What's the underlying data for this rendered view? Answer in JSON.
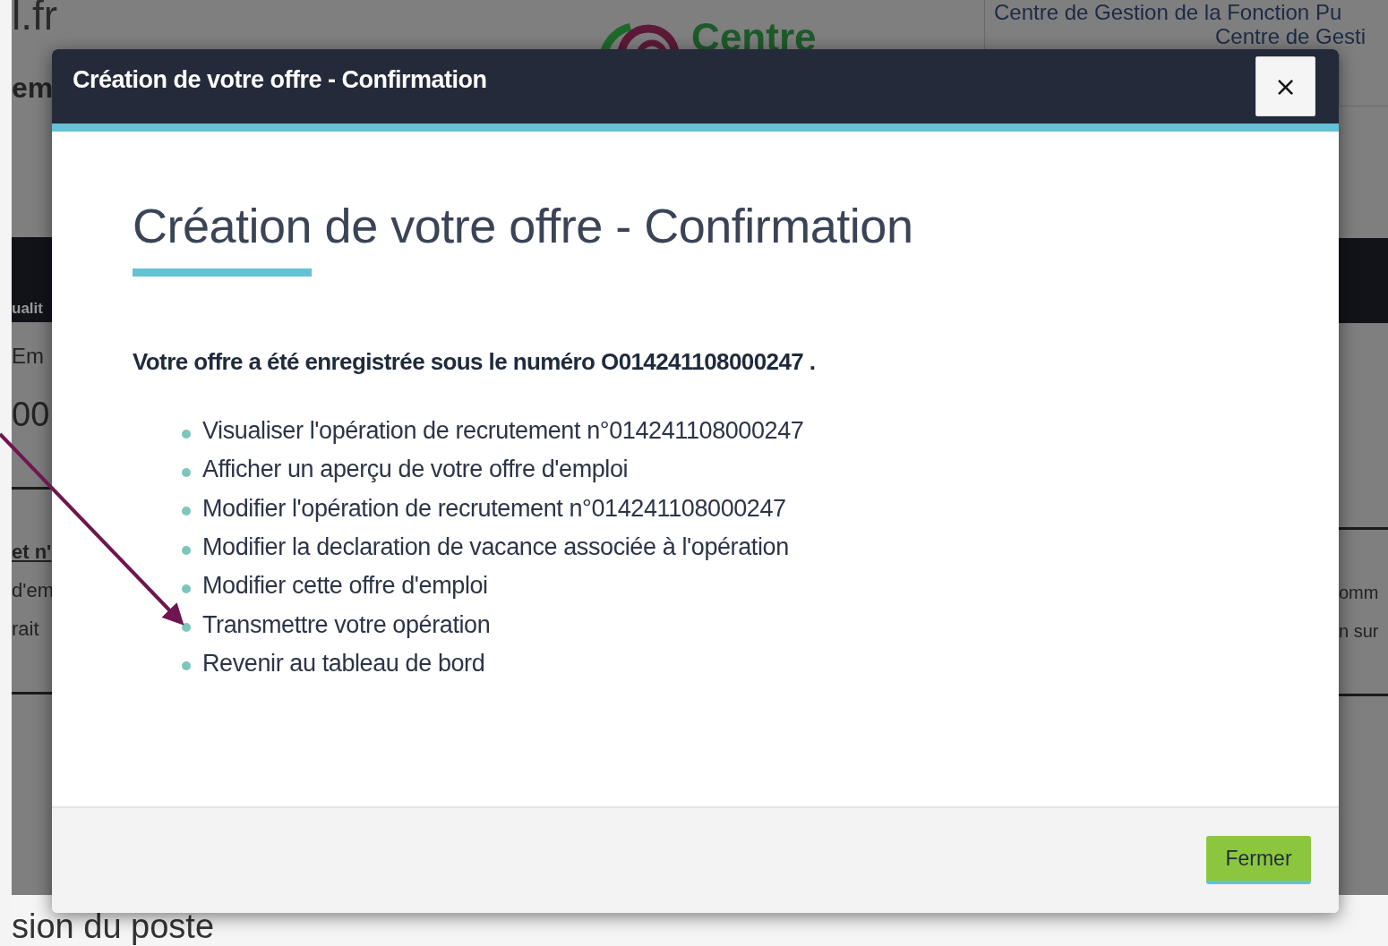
{
  "background": {
    "site_fragment": "l.fr",
    "logo_text": "Centre",
    "header_lines": [
      "Centre de Gestion de la Fonction Pu",
      "Centre de Gesti"
    ],
    "left": {
      "heading": "em",
      "bar_label": "ualit",
      "label": "Em",
      "number": "00",
      "link": "et n'",
      "lines": [
        "d'em",
        "rait"
      ]
    },
    "right": {
      "lines": [
        "omm",
        "n sur"
      ]
    },
    "footer_heading": "sion du poste"
  },
  "modal": {
    "title": "Création de votre offre - Confirmation",
    "close_label": "×",
    "heading": "Création de votre offre - Confirmation",
    "message": "Votre offre a été enregistrée sous le numéro O014241108000247 .",
    "actions": [
      "Visualiser l'opération de recrutement n°014241108000247",
      "Afficher un aperçu de votre offre d'emploi",
      "Modifier l'opération de recrutement n°014241108000247",
      "Modifier la declaration de vacance associée à l'opération",
      "Modifier cette offre d'emploi",
      "Transmettre votre opération",
      "Revenir au tableau de bord"
    ],
    "button": "Fermer"
  }
}
